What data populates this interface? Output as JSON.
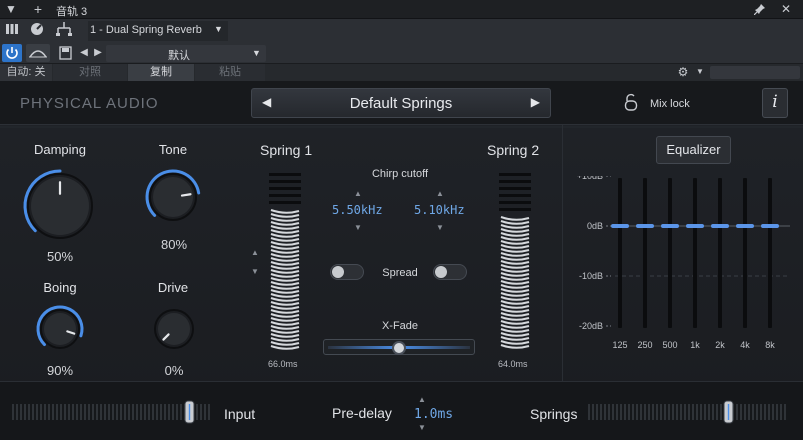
{
  "host": {
    "track_title": "音轨 3",
    "plugin_selector": "1 - Dual Spring Reverb",
    "preset_selector": "默认",
    "auto_label": "自动: 关",
    "compare_label": "对照",
    "copy_label": "复制",
    "paste_label": "粘贴"
  },
  "plugin": {
    "brand": "PHYSICAL AUDIO",
    "preset_name": "Default Springs",
    "mix_lock_label": "Mix lock",
    "info_label": "i"
  },
  "knobs": [
    {
      "label": "Damping",
      "value": "50%",
      "level": 0.5
    },
    {
      "label": "Tone",
      "value": "80%",
      "level": 0.8
    },
    {
      "label": "Boing",
      "value": "90%",
      "level": 0.9
    },
    {
      "label": "Drive",
      "value": "0%",
      "level": 0.0
    }
  ],
  "springs": {
    "spring1_label": "Spring 1",
    "spring2_label": "Spring 2",
    "chirp_label": "Chirp cutoff",
    "chirp1_value": "5.50kHz",
    "chirp2_value": "5.10kHz",
    "spread_label": "Spread",
    "xfade_label": "X-Fade",
    "xfade_level": 0.5,
    "spring1_length": "66.0ms",
    "spring2_length": "64.0ms"
  },
  "equalizer": {
    "button_label": "Equalizer",
    "db_labels": [
      "+10dB",
      "0dB",
      "-10dB",
      "-20dB"
    ],
    "bands": [
      "125",
      "250",
      "500",
      "1k",
      "2k",
      "4k",
      "8k"
    ],
    "gains_db": [
      0,
      0,
      0,
      0,
      0,
      0,
      0
    ]
  },
  "bottom": {
    "input_label": "Input",
    "predelay_label": "Pre-delay",
    "predelay_value": "1.0ms",
    "springs_label": "Springs"
  },
  "colors": {
    "accent": "#4a8ee8",
    "digit": "#6fa7e6",
    "eq_band": "#5b95e8"
  }
}
